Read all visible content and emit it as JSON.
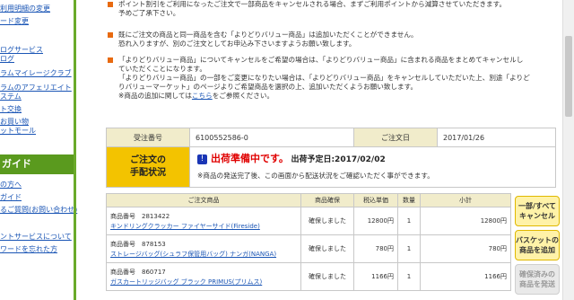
{
  "sidebar": {
    "items": [
      "利用明細の変更",
      "ード変更",
      "ログサービス",
      "ログ",
      "ラムマイレージクラブ",
      "ラムのアフェリエイト",
      "ステム",
      "ト交換",
      "お買い物",
      "ットモール"
    ],
    "guide_header": "ガイド",
    "guide_items": [
      "の方へ",
      "ガイド",
      "るご質問(お問い合わせ)",
      "ントサービスについて",
      "ワードを忘れた方"
    ]
  },
  "notes": [
    {
      "lines": [
        "ポイント割引をご利用になったご注文で一部商品をキャンセルされる場合、まずご利用ポイントから減算させていただきます。",
        "予めご了承下さい。"
      ]
    },
    {
      "lines": [
        "既にご注文の商品と同一商品を含む「よりどりバリュー商品」は追加いただくことができません。",
        "恐れ入りますが、別のご注文としてお申込み下さいますようお願い致します。"
      ]
    },
    {
      "lines": [
        "「よりどりバリュー商品」についてキャンセルをご希望の場合は、「よりどりバリュー商品」に含まれる商品をまとめてキャンセルし",
        "ていただくことになります。",
        "「よりどりバリュー商品」の一部をご変更になりたい場合は、「よりどりバリュー商品」をキャンセルしていただいた上、別途「よりど",
        "りバリューマーケット」のページよりご希望商品を選択の上、追加いただくようお願い致します。"
      ],
      "link_line": {
        "prefix": "※商品の追加に関しては",
        "link": "こちら",
        "suffix": "をご参照ください。"
      }
    }
  ],
  "order": {
    "number_label": "受注番号",
    "number": "6100552586-0",
    "date_label": "ご注文日",
    "date": "2017/01/26",
    "status_label_1": "ご注文の",
    "status_label_2": "手配状況",
    "status_icon": "!",
    "status_main": "出荷準備中です。",
    "status_date": "出荷予定日:2017/02/02",
    "status_note": "※商品の発送完了後、この画面から配送状況をご確認いただく事ができます。"
  },
  "items": {
    "headers": [
      "ご注文商品",
      "商品確保",
      "税込単価",
      "数量",
      "小計"
    ],
    "rows": [
      {
        "number": "商品番号　2813422",
        "name": "キンドリングクラッカー ファイヤーサイド(Fireside)",
        "status": "確保しました",
        "price": "12800円",
        "qty": "1",
        "subtotal": "12800円"
      },
      {
        "number": "商品番号　878153",
        "name": "ストレージバッグ(シュラフ保管用バッグ) ナンガ(NANGA)",
        "status": "確保しました",
        "price": "780円",
        "qty": "1",
        "subtotal": "780円"
      },
      {
        "number": "商品番号　860717",
        "name": "ガスカートリッジバッグ ブラック PRIMUS(プリムス)",
        "status": "確保しました",
        "price": "1166円",
        "qty": "1",
        "subtotal": "1166円"
      }
    ]
  },
  "actions": {
    "cancel_1": "一部/すべて",
    "cancel_2": "キャンセル",
    "add_1": "バスケットの",
    "add_2": "商品を追加",
    "ship_1": "確保済みの",
    "ship_2": "商品を発送"
  }
}
